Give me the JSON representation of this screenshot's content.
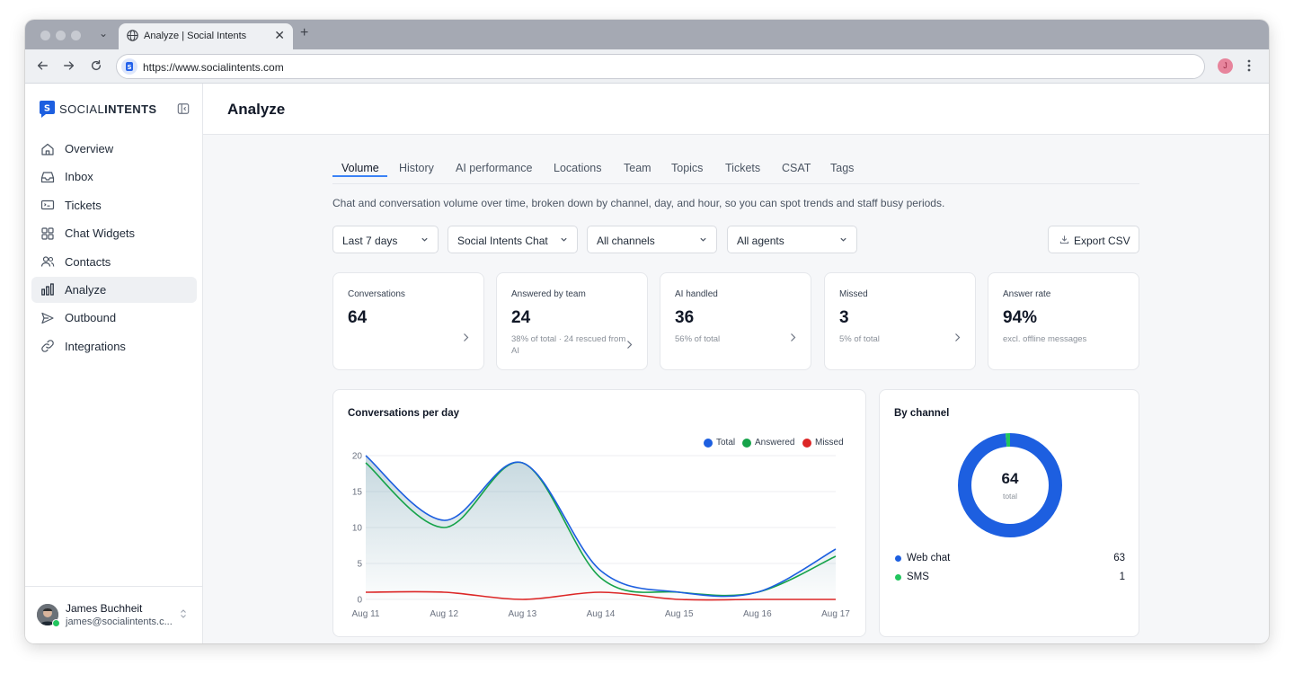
{
  "browser": {
    "tab_title": "Analyze | Social Intents",
    "tab_close": "✕",
    "new_tab": "+",
    "url": "https://www.socialintents.com",
    "profile_initial": "J"
  },
  "sidebar": {
    "logo_social": "SOCIAL",
    "logo_intents": "INTENTS",
    "items": [
      {
        "label": "Overview",
        "icon": "home-icon"
      },
      {
        "label": "Inbox",
        "icon": "inbox-icon"
      },
      {
        "label": "Tickets",
        "icon": "ticket-icon"
      },
      {
        "label": "Chat Widgets",
        "icon": "grid-icon"
      },
      {
        "label": "Contacts",
        "icon": "users-icon"
      },
      {
        "label": "Analyze",
        "icon": "bar-chart-icon",
        "active": true
      },
      {
        "label": "Outbound",
        "icon": "send-icon"
      },
      {
        "label": "Integrations",
        "icon": "link-icon"
      }
    ],
    "user": {
      "name": "James Buchheit",
      "email": "james@socialintents.c..."
    }
  },
  "page": {
    "title": "Analyze",
    "tabs": [
      "Volume",
      "History",
      "AI performance",
      "Locations",
      "Team",
      "Topics",
      "Tickets",
      "CSAT",
      "Tags"
    ],
    "active_tab": "Volume",
    "description": "Chat and conversation volume over time, broken down by channel, day, and hour, so you can spot trends and staff busy periods.",
    "filters": {
      "range": "Last 7 days",
      "widget": "Social Intents Chat",
      "channel": "All channels",
      "agent": "All agents"
    },
    "export_label": "Export CSV"
  },
  "stats": [
    {
      "label": "Conversations",
      "value": "64",
      "sub": ""
    },
    {
      "label": "Answered by team",
      "value": "24",
      "sub": "38% of total · 24 rescued from AI"
    },
    {
      "label": "AI handled",
      "value": "36",
      "sub": "56% of total"
    },
    {
      "label": "Missed",
      "value": "3",
      "sub": "5% of total"
    },
    {
      "label": "Answer rate",
      "value": "94%",
      "sub": "excl. offline messages"
    }
  ],
  "chart_data": [
    {
      "type": "line",
      "title": "Conversations per day",
      "x": [
        "Aug 11",
        "Aug 12",
        "Aug 13",
        "Aug 14",
        "Aug 15",
        "Aug 16",
        "Aug 17"
      ],
      "yticks": [
        0,
        5,
        10,
        15,
        20
      ],
      "ylim": [
        0,
        20
      ],
      "grid": true,
      "legend": "top-right",
      "series": [
        {
          "name": "Total",
          "color": "#1d5fe0",
          "values": [
            20,
            11,
            19,
            4,
            1,
            1,
            7
          ]
        },
        {
          "name": "Answered",
          "color": "#16a34a",
          "values": [
            19,
            10,
            19,
            3,
            1,
            1,
            6
          ]
        },
        {
          "name": "Missed",
          "color": "#dc2626",
          "values": [
            1,
            1,
            0,
            1,
            0,
            0,
            0
          ]
        }
      ]
    },
    {
      "type": "pie",
      "title": "By channel",
      "center_value": "64",
      "center_label": "total",
      "slices": [
        {
          "name": "Web chat",
          "value": 63,
          "color": "#1d5fe0"
        },
        {
          "name": "SMS",
          "value": 1,
          "color": "#22c55e"
        }
      ]
    }
  ]
}
